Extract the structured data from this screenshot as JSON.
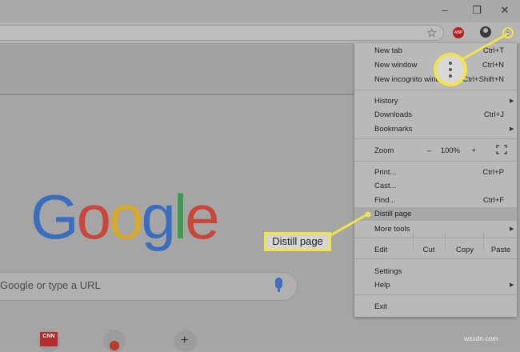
{
  "window": {
    "minimize": "–",
    "restore": "❐",
    "close": "✕"
  },
  "toolbar": {
    "bookmark_icon": "☆",
    "abp_label": "ABP"
  },
  "newtab": {
    "logo_letters": [
      "G",
      "o",
      "o",
      "g",
      "l",
      "e"
    ],
    "search_placeholder": "Google or type a URL",
    "cnn_label": "CNN",
    "add_shortcut": "+"
  },
  "menu": {
    "items": [
      {
        "label": "New tab",
        "shortcut": "Ctrl+T"
      },
      {
        "label": "New window",
        "shortcut": "Ctrl+N"
      },
      {
        "label": "New incognito window",
        "shortcut": "Ctrl+Shift+N"
      },
      {
        "label": "History",
        "submenu": true
      },
      {
        "label": "Downloads",
        "shortcut": "Ctrl+J"
      },
      {
        "label": "Bookmarks",
        "submenu": true
      },
      {
        "label": "Print...",
        "shortcut": "Ctrl+P"
      },
      {
        "label": "Cast..."
      },
      {
        "label": "Find...",
        "shortcut": "Ctrl+F"
      },
      {
        "label": "Distill page",
        "highlighted": true
      },
      {
        "label": "More tools",
        "submenu": true
      },
      {
        "label": "Settings"
      },
      {
        "label": "Help",
        "submenu": true
      },
      {
        "label": "Exit"
      }
    ],
    "zoom": {
      "label": "Zoom",
      "minus": "–",
      "value": "100%",
      "plus": "+",
      "fullscreen_icon": "fullscreen-icon"
    },
    "edit": {
      "label": "Edit",
      "cut": "Cut",
      "copy": "Copy",
      "paste": "Paste"
    }
  },
  "callout": {
    "label": "Distill page",
    "highlight_color": "#f0e34c"
  },
  "watermark": "wsxdn.com"
}
